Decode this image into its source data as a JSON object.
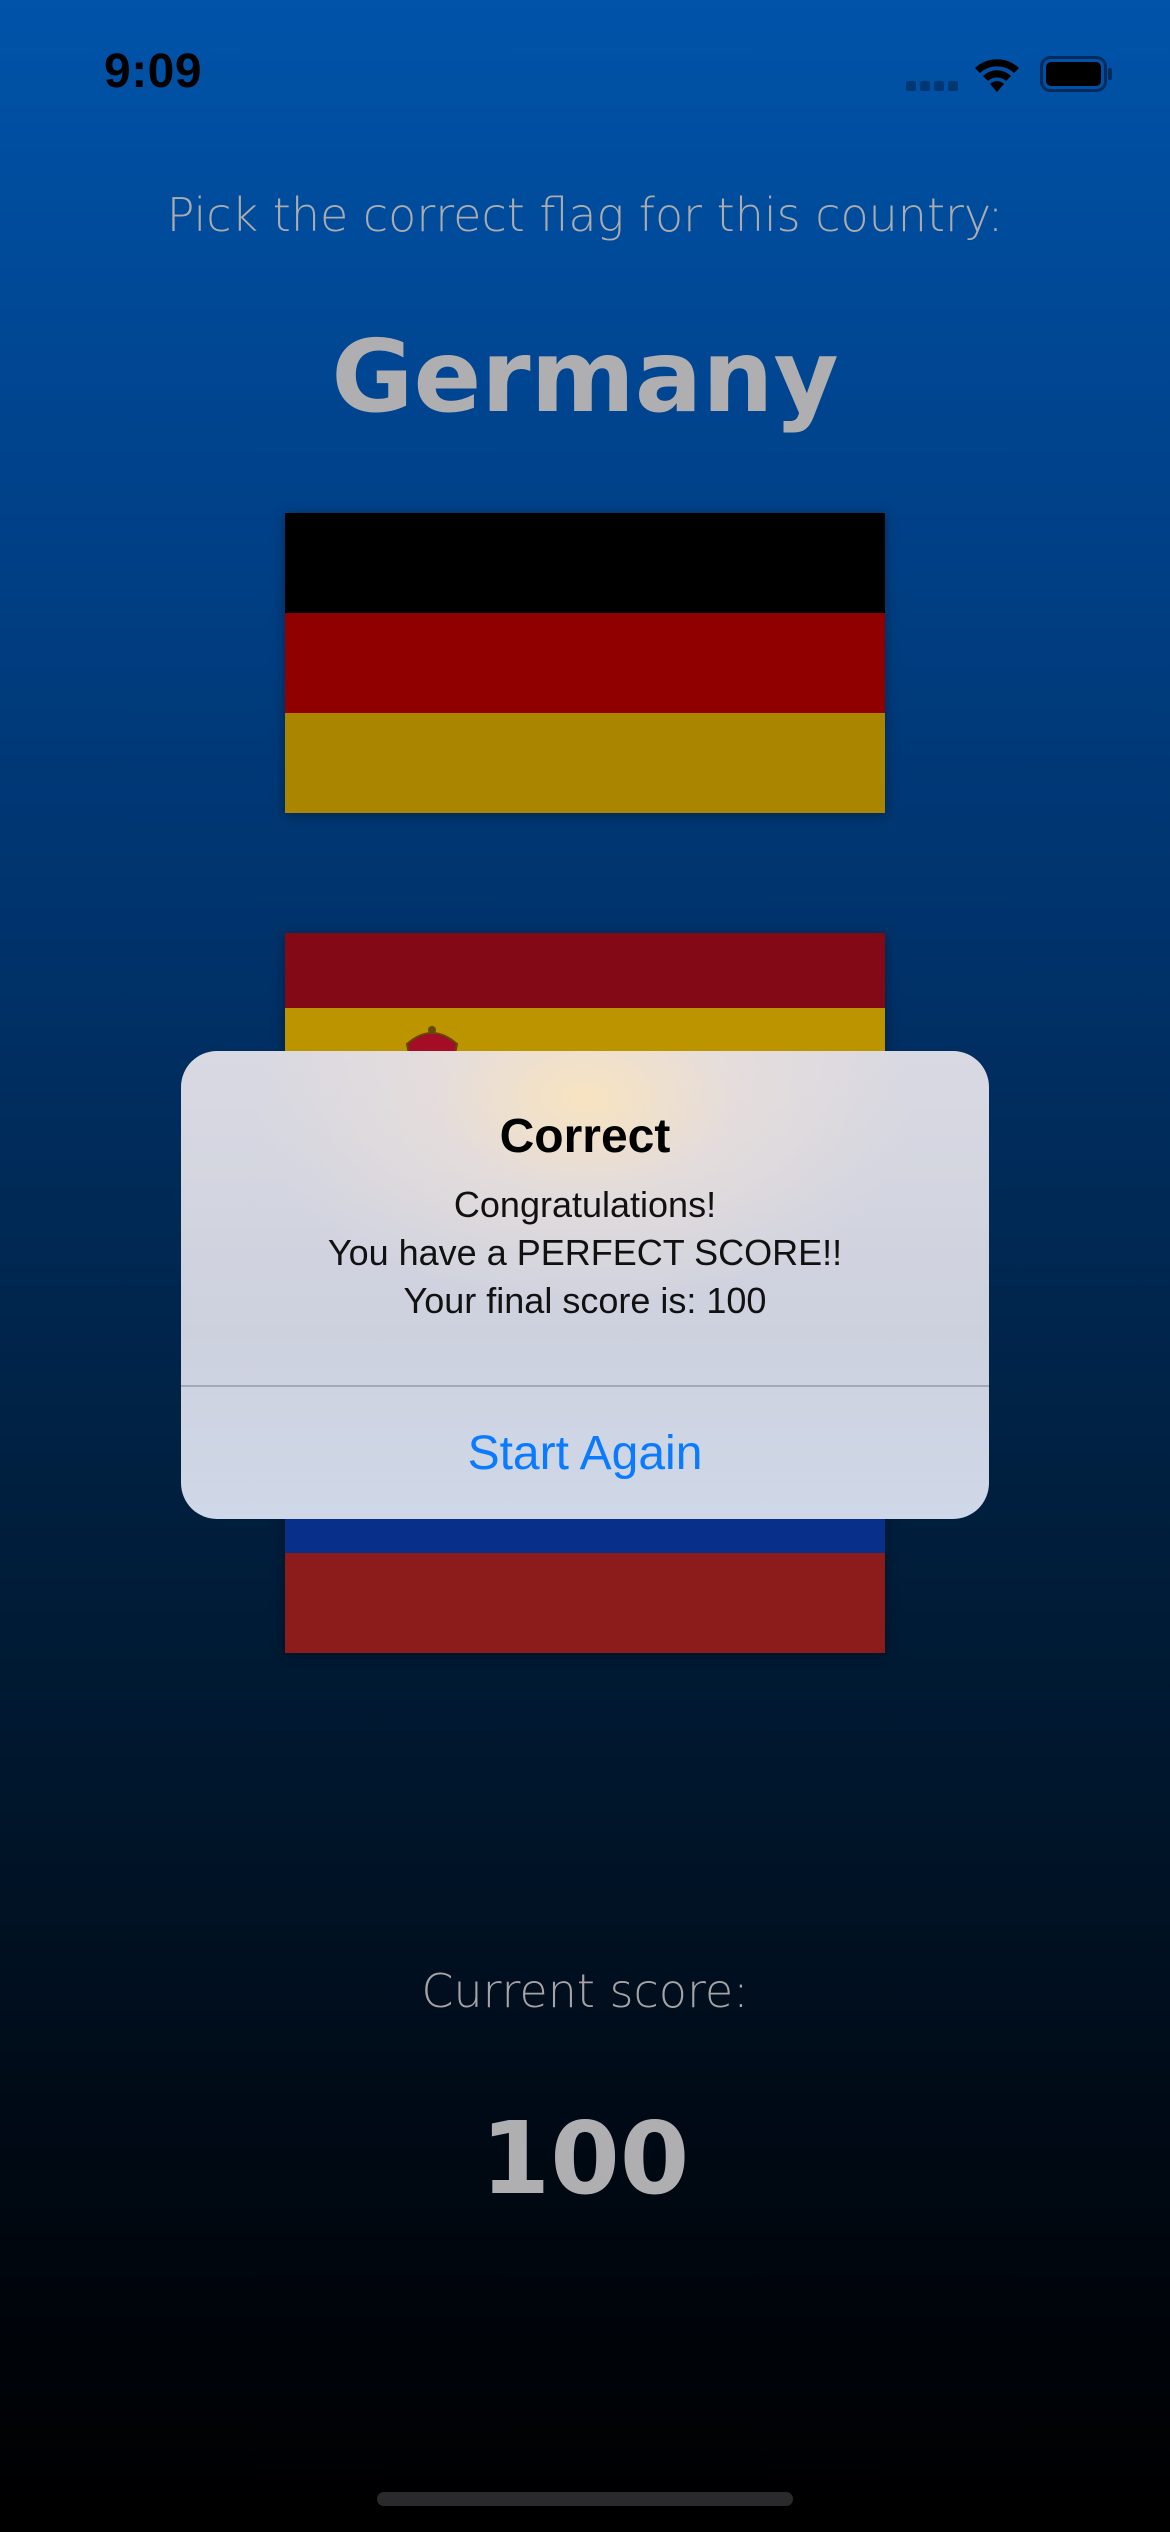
{
  "status_bar": {
    "time": "9:09"
  },
  "game": {
    "prompt": "Pick the correct flag for this country:",
    "country": "Germany",
    "score_label": "Current score:",
    "score_value": "100"
  },
  "flags": [
    {
      "country": "Germany",
      "colors": [
        "#000000",
        "#b00000",
        "#d0a400"
      ]
    },
    {
      "country": "Spain",
      "colors": [
        "#a20c1c",
        "#e4b500",
        "#a20c1c"
      ]
    },
    {
      "country": "Russia",
      "colors": [
        "#ffffff",
        "#0a3aa8",
        "#ab2121"
      ]
    }
  ],
  "alert": {
    "title": "Correct",
    "message_lines": [
      "Congratulations!",
      "You have a PERFECT SCORE!!",
      "Your final score is: 100"
    ],
    "button_label": "Start Again"
  },
  "colors": {
    "accent": "#0a7aff",
    "background_top": "#0066cf",
    "background_bottom": "#000000"
  },
  "icons": {
    "signal": "cellular-signal-icon",
    "wifi": "wifi-icon",
    "battery": "battery-icon"
  }
}
